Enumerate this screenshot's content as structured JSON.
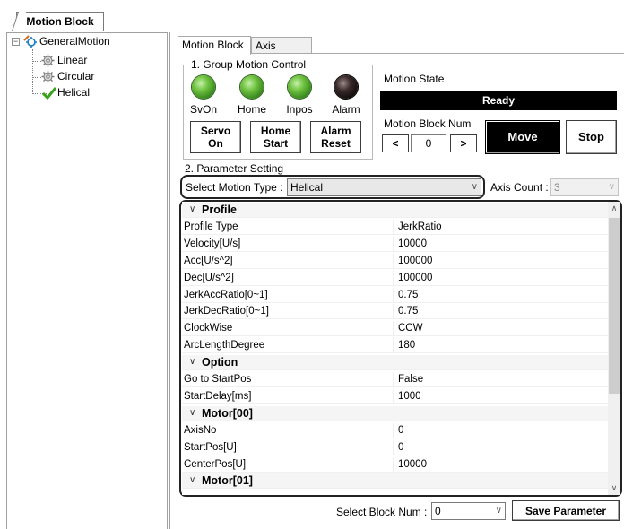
{
  "main_tab": "Motion Block",
  "tree": {
    "root": "GeneralMotion",
    "items": [
      "Linear",
      "Circular",
      "Helical"
    ]
  },
  "subtabs": [
    "Motion Block",
    "Axis Status"
  ],
  "group1": {
    "title": "1. Group Motion Control",
    "leds": [
      {
        "label": "SvOn",
        "state": "green"
      },
      {
        "label": "Home",
        "state": "green"
      },
      {
        "label": "Inpos",
        "state": "green"
      },
      {
        "label": "Alarm",
        "state": "dark"
      }
    ],
    "buttons": {
      "servo_line1": "Servo",
      "servo_line2": "On",
      "home_line1": "Home",
      "home_line2": "Start",
      "alarm_line1": "Alarm",
      "alarm_line2": "Reset"
    },
    "motion_state_label": "Motion State",
    "motion_state_value": "Ready",
    "block_num_label": "Motion Block Num",
    "prev": "<",
    "next": ">",
    "block_num_value": "0",
    "move": "Move",
    "stop": "Stop"
  },
  "group2": {
    "title": "2. Parameter Setting",
    "motion_type_label": "Select Motion Type :",
    "motion_type_value": "Helical",
    "axis_count_label": "Axis Count :",
    "axis_count_value": "3"
  },
  "params": [
    {
      "type": "cat",
      "label": "Profile"
    },
    {
      "type": "row",
      "key": "Profile Type",
      "value": "JerkRatio"
    },
    {
      "type": "row",
      "key": "Velocity[U/s]",
      "value": "10000"
    },
    {
      "type": "row",
      "key": "Acc[U/s^2]",
      "value": "100000"
    },
    {
      "type": "row",
      "key": "Dec[U/s^2]",
      "value": "100000"
    },
    {
      "type": "row",
      "key": "JerkAccRatio[0~1]",
      "value": "0.75"
    },
    {
      "type": "row",
      "key": "JerkDecRatio[0~1]",
      "value": "0.75"
    },
    {
      "type": "row",
      "key": "ClockWise",
      "value": "CCW"
    },
    {
      "type": "row",
      "key": "ArcLengthDegree",
      "value": "180"
    },
    {
      "type": "cat",
      "label": "Option"
    },
    {
      "type": "row",
      "key": "Go to StartPos",
      "value": "False"
    },
    {
      "type": "row",
      "key": "StartDelay[ms]",
      "value": "1000"
    },
    {
      "type": "cat",
      "label": "Motor[00]"
    },
    {
      "type": "row",
      "key": "AxisNo",
      "value": "0"
    },
    {
      "type": "row",
      "key": "StartPos[U]",
      "value": "0"
    },
    {
      "type": "row",
      "key": "CenterPos[U]",
      "value": "10000"
    },
    {
      "type": "cat",
      "label": "Motor[01]"
    }
  ],
  "footer": {
    "select_block_label": "Select Block Num :",
    "select_block_value": "0",
    "save": "Save Parameter"
  }
}
